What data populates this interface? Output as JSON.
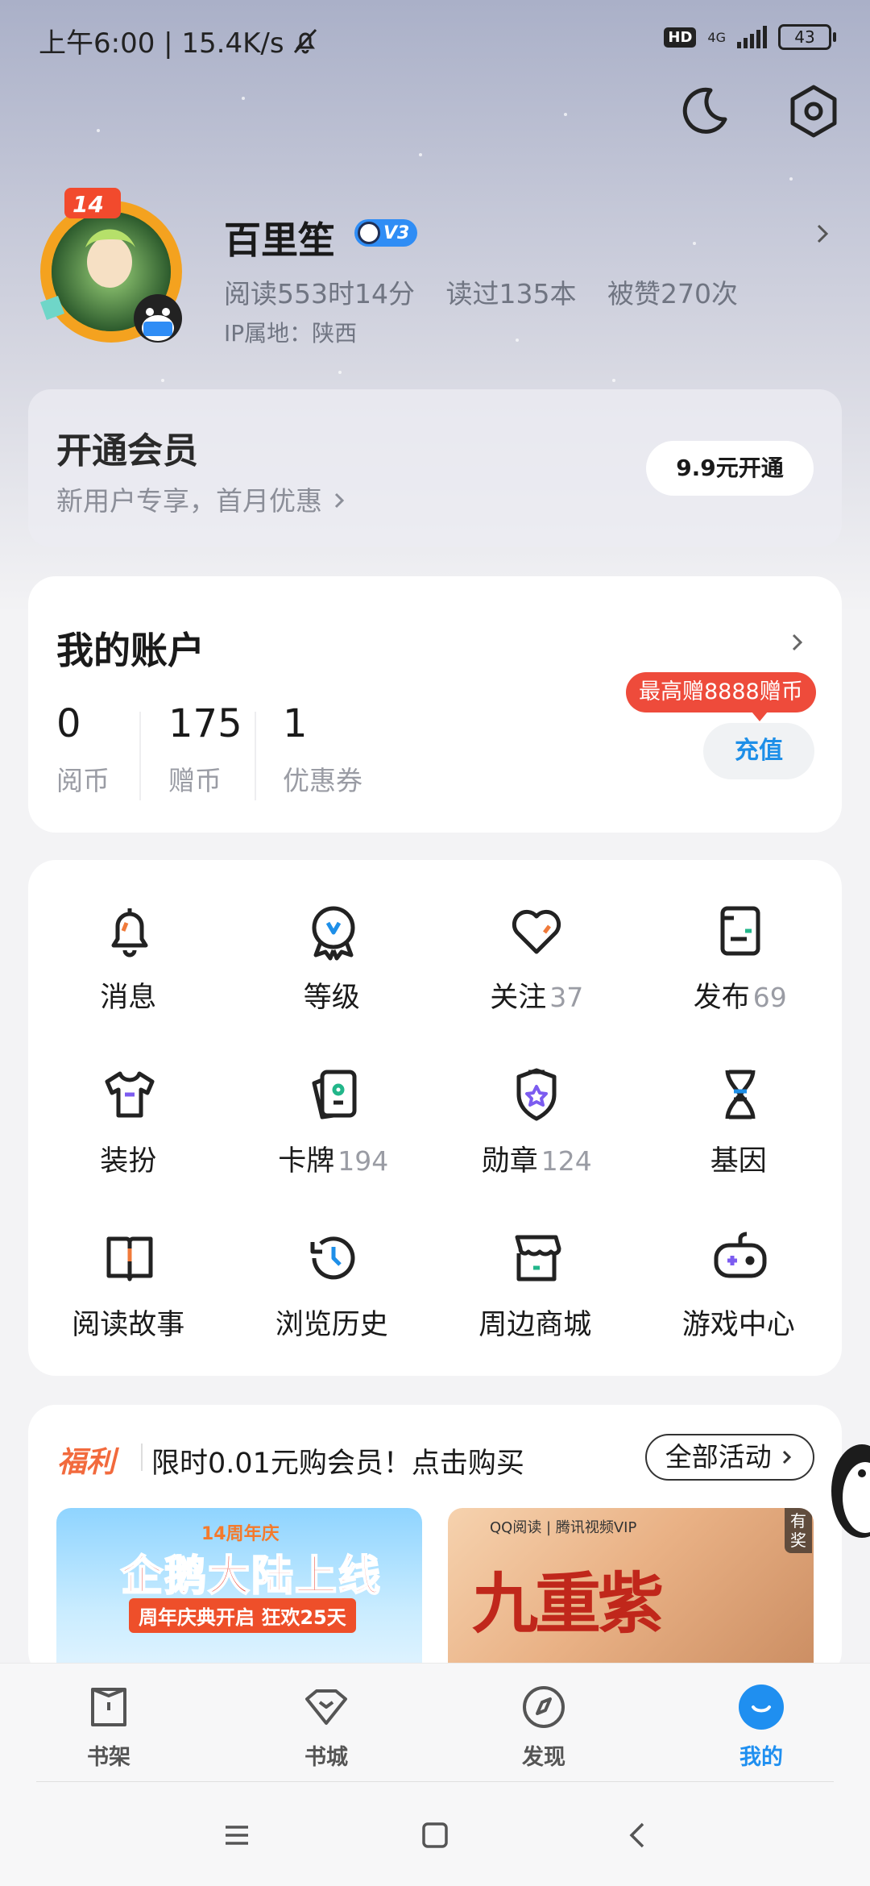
{
  "status_bar": {
    "time_text": "上午6:00 | 15.4K/s",
    "hd": "HD",
    "network": "4G",
    "battery": "43"
  },
  "profile": {
    "name": "百里笙",
    "level": "V3",
    "stats": [
      "阅读553时14分",
      "读过135本",
      "被赞270次"
    ],
    "ip": "IP属地：陕西"
  },
  "vip": {
    "title": "开通会员",
    "subtitle": "新用户专享，首月优惠",
    "button": "9.9元开通"
  },
  "account": {
    "title": "我的账户",
    "items": [
      {
        "value": "0",
        "label": "阅币"
      },
      {
        "value": "175",
        "label": "赠币"
      },
      {
        "value": "1",
        "label": "优惠券"
      }
    ],
    "promo": "最高赠8888赠币",
    "recharge": "充值"
  },
  "grid": [
    {
      "label": "消息",
      "count": "",
      "icon": "bell-icon"
    },
    {
      "label": "等级",
      "count": "",
      "icon": "level-medal-icon"
    },
    {
      "label": "关注",
      "count": "37",
      "icon": "heart-icon"
    },
    {
      "label": "发布",
      "count": "69",
      "icon": "document-icon"
    },
    {
      "label": "装扮",
      "count": "",
      "icon": "tshirt-icon"
    },
    {
      "label": "卡牌",
      "count": "194",
      "icon": "cards-icon"
    },
    {
      "label": "勋章",
      "count": "124",
      "icon": "badge-star-icon"
    },
    {
      "label": "基因",
      "count": "",
      "icon": "dna-icon"
    },
    {
      "label": "阅读故事",
      "count": "",
      "icon": "book-icon"
    },
    {
      "label": "浏览历史",
      "count": "",
      "icon": "clock-history-icon"
    },
    {
      "label": "周边商城",
      "count": "",
      "icon": "shop-icon"
    },
    {
      "label": "游戏中心",
      "count": "",
      "icon": "gamepad-icon"
    }
  ],
  "welfare": {
    "tag": "福利",
    "text": "限时0.01元购会员！点击购买",
    "all_button": "全部活动",
    "banner1": {
      "top": "14周年庆",
      "main": "企鹅大陆上线",
      "sub": "周年庆典开启 狂欢25天"
    },
    "banner2": {
      "brand": "QQ阅读 | 腾讯视频VIP",
      "title": "九重紫",
      "tag": "有奖"
    }
  },
  "nav": [
    {
      "label": "书架",
      "icon": "bookshelf-icon",
      "active": false
    },
    {
      "label": "书城",
      "icon": "bookstore-icon",
      "active": false
    },
    {
      "label": "发现",
      "icon": "discover-compass-icon",
      "active": false
    },
    {
      "label": "我的",
      "icon": "me-icon",
      "active": true
    }
  ],
  "colors": {
    "accent": "#1f8ff0",
    "promo_red": "#ee4b3b",
    "welfare_orange": "#f26a3d",
    "icon_orange": "#f07a3a"
  }
}
